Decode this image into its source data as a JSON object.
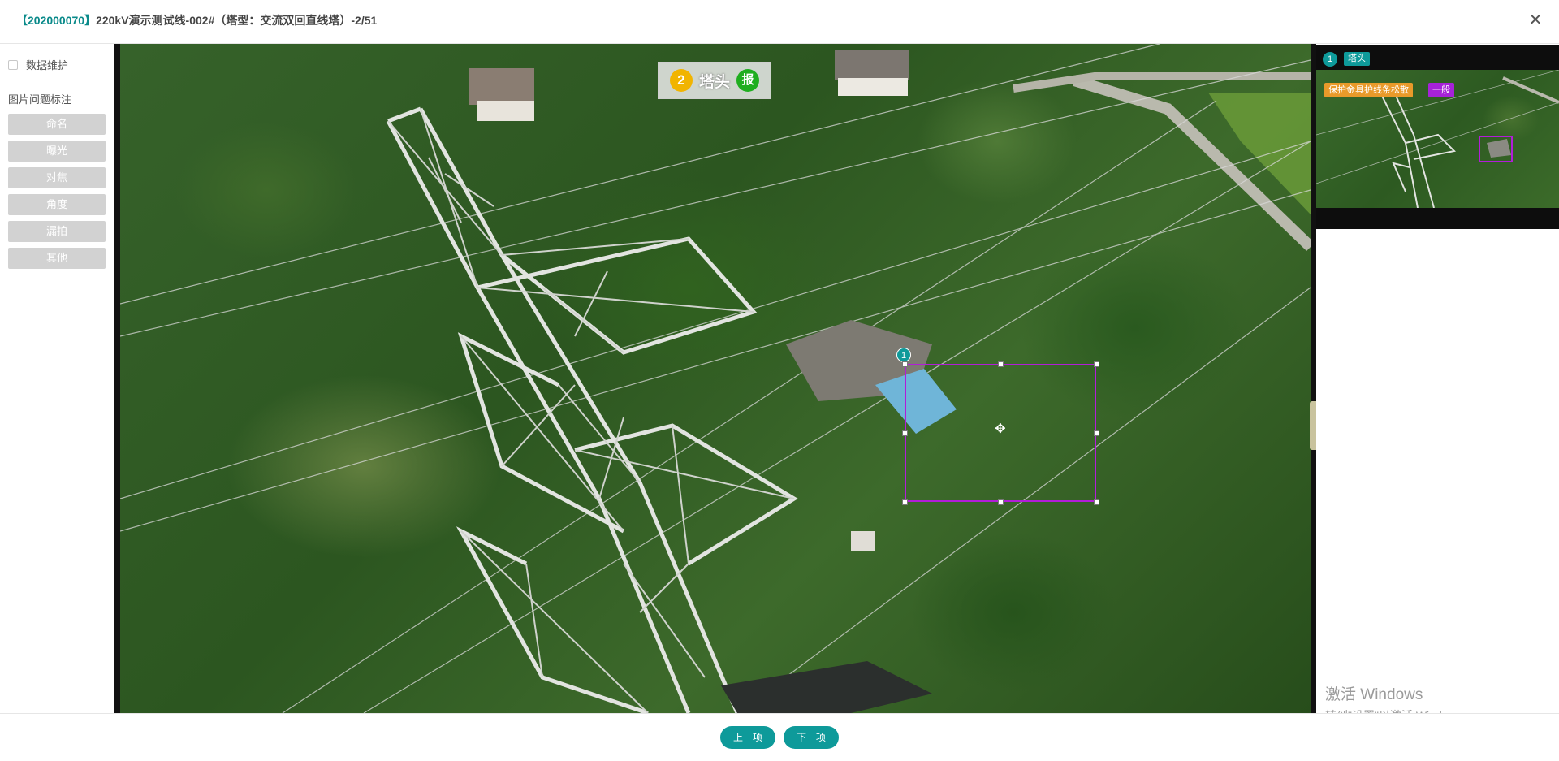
{
  "header": {
    "code": "【202000070】",
    "title": "220kV演示测试线-002#（塔型：交流双回直线塔）-2/51",
    "close_icon": "close-icon"
  },
  "sidebar": {
    "data_maintenance_label": "数据维护",
    "data_maintenance_checked": false,
    "issue_section_title": "图片问题标注",
    "issue_buttons": [
      "命名",
      "曝光",
      "对焦",
      "角度",
      "漏拍",
      "其他"
    ]
  },
  "viewer": {
    "part_number": "2",
    "part_label": "塔头",
    "report_label": "报",
    "annotation_number": "1",
    "annotation_color": "#b21dd8"
  },
  "thumbnail": {
    "number": "1",
    "part_tag": "塔头",
    "defect_tag": "保护金具护线条松散",
    "level_tag": "一般",
    "colors": {
      "teal": "#0e9a9a",
      "defect": "#e99a2a",
      "level": "#a622d8"
    }
  },
  "watermark": {
    "line1": "激活 Windows",
    "line2": "转到\"设置\"以激活 Windows。"
  },
  "footer": {
    "prev_label": "上一项",
    "next_label": "下一项"
  }
}
